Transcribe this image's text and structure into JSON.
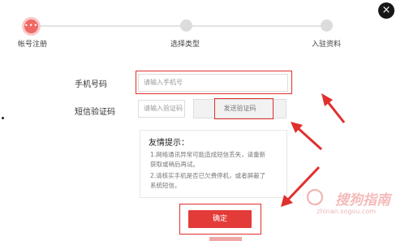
{
  "steps": [
    {
      "label": "帐号注册",
      "state": "active"
    },
    {
      "label": "选择类型",
      "state": "pending"
    },
    {
      "label": "入驻资料",
      "state": "pending"
    }
  ],
  "active_step_glyph": "•••",
  "close_icon": "×",
  "form": {
    "phone_label": "手机号码",
    "phone_placeholder": "请输入手机号",
    "code_label": "短信验证码",
    "code_placeholder": "请输入验证码",
    "send_code_label": "发送验证码"
  },
  "tips": {
    "title": "友情提示：",
    "lines": [
      "1.网络通讯异常可能造成短信丢失，请重新",
      "获取或稍后再试。",
      "2.请核实手机是否已欠费停机，或者屏蔽了",
      "系统短信。"
    ]
  },
  "confirm_label": "确定",
  "watermark": {
    "text": "搜狗指南",
    "sub": "zhinan.sogou.com"
  },
  "colors": {
    "accent": "#e33b38",
    "annotation": "#e0302d",
    "step_inactive": "#dcdcdc"
  }
}
